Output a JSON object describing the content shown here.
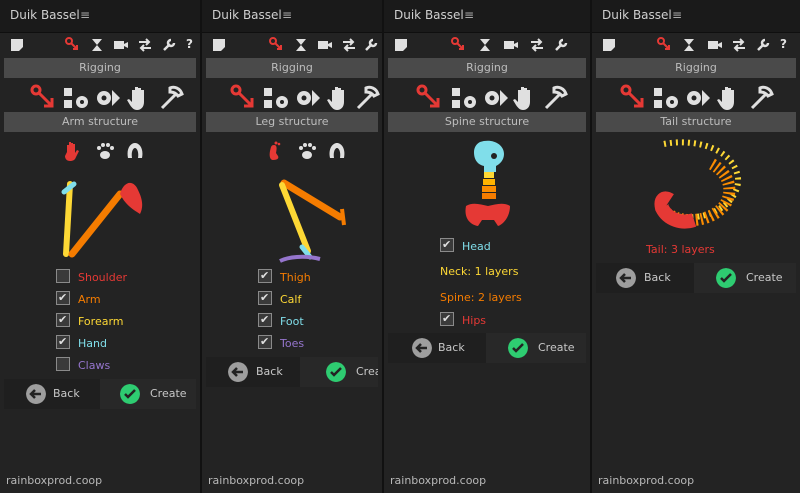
{
  "panels": [
    {
      "title": "Duik Bassel",
      "section1": "Rigging",
      "section2": "Arm structure",
      "items": [
        {
          "label": "Shoulder",
          "checked": false,
          "color": "#e53935"
        },
        {
          "label": "Arm",
          "checked": true,
          "color": "#f57c00"
        },
        {
          "label": "Forearm",
          "checked": true,
          "color": "#fdd835"
        },
        {
          "label": "Hand",
          "checked": true,
          "color": "#80deea"
        },
        {
          "label": "Claws",
          "checked": false,
          "color": "#9575cd"
        }
      ],
      "back": "Back",
      "create": "Create",
      "footer": "rainboxprod.coop"
    },
    {
      "title": "Duik Bassel",
      "section1": "Rigging",
      "section2": "Leg structure",
      "items": [
        {
          "label": "Thigh",
          "checked": true,
          "color": "#f57c00"
        },
        {
          "label": "Calf",
          "checked": true,
          "color": "#fdd835"
        },
        {
          "label": "Foot",
          "checked": true,
          "color": "#80deea"
        },
        {
          "label": "Toes",
          "checked": true,
          "color": "#9575cd"
        }
      ],
      "back": "Back",
      "create": "Create",
      "footer": "rainboxprod.coop"
    },
    {
      "title": "Duik Bassel",
      "section1": "Rigging",
      "section2": "Spine structure",
      "head": {
        "label": "Head",
        "checked": true,
        "color": "#80deea"
      },
      "neck": {
        "label": "Neck: 1 layers",
        "color": "#fdd835"
      },
      "spine": {
        "label": "Spine: 2 layers",
        "color": "#f57c00"
      },
      "hips": {
        "label": "Hips",
        "checked": true,
        "color": "#e53935"
      },
      "back": "Back",
      "create": "Create",
      "footer": "rainboxprod.coop"
    },
    {
      "title": "Duik Bassel",
      "section1": "Rigging",
      "section2": "Tail structure",
      "tail": {
        "label": "Tail: 3 layers",
        "color": "#e53935"
      },
      "back": "Back",
      "create": "Create",
      "footer": "rainboxprod.coop"
    }
  ],
  "colors": {
    "accent_red": "#e53935",
    "check_green": "#2ecc71",
    "back_grey": "#9e9e9e"
  }
}
